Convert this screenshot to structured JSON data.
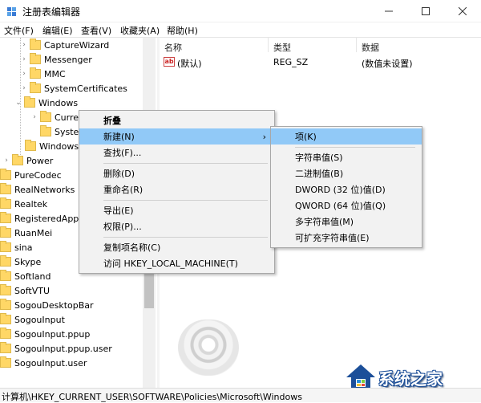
{
  "window": {
    "title": "注册表编辑器"
  },
  "menu": [
    "文件(F)",
    "编辑(E)",
    "查看(V)",
    "收藏夹(A)",
    "帮助(H)"
  ],
  "tree": {
    "upper": [
      {
        "label": "CaptureWizard"
      },
      {
        "label": "Messenger"
      },
      {
        "label": "MMC"
      },
      {
        "label": "SystemCertificates"
      },
      {
        "label": "Windows"
      },
      {
        "label": "Curre"
      },
      {
        "label": "Syster"
      },
      {
        "label": "Windows"
      },
      {
        "label": "Power"
      }
    ],
    "lower": [
      {
        "label": "PureCodec"
      },
      {
        "label": "RealNetworks"
      },
      {
        "label": "Realtek"
      },
      {
        "label": "RegisteredAppl"
      },
      {
        "label": "RuanMei"
      },
      {
        "label": "sina"
      },
      {
        "label": "Skype"
      },
      {
        "label": "Softland"
      },
      {
        "label": "SoftVTU"
      },
      {
        "label": "SogouDesktopBar"
      },
      {
        "label": "SogouInput"
      },
      {
        "label": "SogouInput.ppup"
      },
      {
        "label": "SogouInput.ppup.user"
      },
      {
        "label": "SogouInput.user"
      }
    ]
  },
  "list": {
    "columns": [
      "名称",
      "类型",
      "数据"
    ],
    "rows": [
      {
        "name": "(默认)",
        "type": "REG_SZ",
        "data": "(数值未设置)"
      }
    ]
  },
  "context_menu": {
    "items": [
      "折叠",
      "新建(N)",
      "查找(F)...",
      "删除(D)",
      "重命名(R)",
      "导出(E)",
      "权限(P)...",
      "复制项名称(C)",
      "访问 HKEY_LOCAL_MACHINE(T)"
    ]
  },
  "submenu": {
    "items": [
      "项(K)",
      "字符串值(S)",
      "二进制值(B)",
      "DWORD (32 位)值(D)",
      "QWORD (64 位)值(Q)",
      "多字符串值(M)",
      "可扩充字符串值(E)"
    ]
  },
  "status": "计算机\\HKEY_CURRENT_USER\\SOFTWARE\\Policies\\Microsoft\\Windows",
  "logo": {
    "text": "系统之家"
  },
  "colors": {
    "highlight": "#91c9f7",
    "folder": "#ffd766",
    "logo_blue": "#1c4f99"
  }
}
